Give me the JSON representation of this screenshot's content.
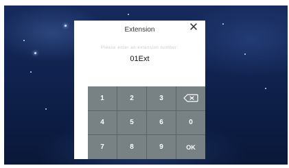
{
  "dialog": {
    "title": "Extension",
    "close_glyph": "✕",
    "prompt": "Please enter an extension number:",
    "value": "01Ext"
  },
  "keypad": {
    "keys": [
      {
        "label": "1",
        "name": "key-1"
      },
      {
        "label": "2",
        "name": "key-2"
      },
      {
        "label": "3",
        "name": "key-3"
      },
      {
        "label": "",
        "name": "backspace-button",
        "icon": "backspace-icon"
      },
      {
        "label": "4",
        "name": "key-4"
      },
      {
        "label": "5",
        "name": "key-5"
      },
      {
        "label": "6",
        "name": "key-6"
      },
      {
        "label": "0",
        "name": "key-0"
      },
      {
        "label": "7",
        "name": "key-7"
      },
      {
        "label": "8",
        "name": "key-8"
      },
      {
        "label": "9",
        "name": "key-9"
      },
      {
        "label": "OK",
        "name": "ok-button"
      }
    ]
  },
  "colors": {
    "key_background": "#788284",
    "key_text": "#ffffff",
    "dialog_background": "#ffffff",
    "wallpaper": "#12265a"
  }
}
